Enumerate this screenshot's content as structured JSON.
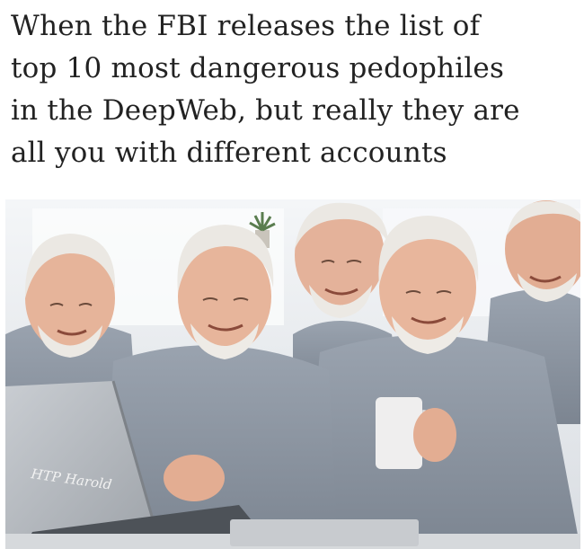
{
  "caption": {
    "lines": [
      "When the FBI releases the list of",
      "top 10 most dangerous pedophiles",
      "in the DeepWeb, but really they are",
      "all you with different accounts"
    ]
  },
  "photo": {
    "laptop_label": "HTP Harold"
  },
  "colors": {
    "background": "#ffffff",
    "caption_text": "#222222",
    "shirt": "#8d96a3",
    "skin": "#e6b49a",
    "hair": "#e9e6e1",
    "laptop": "#b9bdc2"
  }
}
